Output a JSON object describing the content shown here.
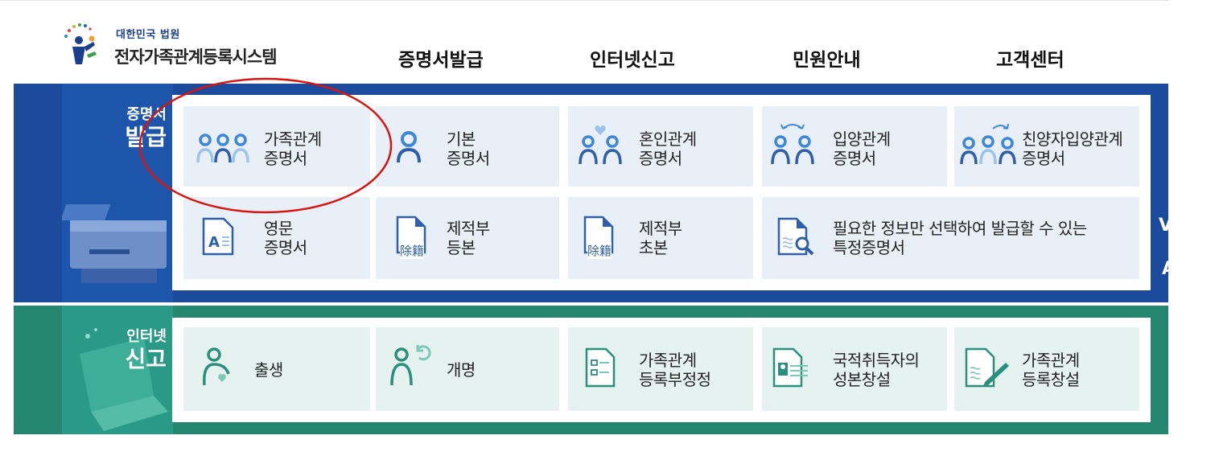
{
  "header": {
    "logo_sub": "대한민국 법원",
    "logo_title": "전자가족관계등록시스템",
    "nav": [
      "증명서발급",
      "인터넷신고",
      "민원안내",
      "고객센터"
    ]
  },
  "certificates": {
    "title_line1": "증명서",
    "title_line2": "발급",
    "tiles": [
      {
        "line1": "가족관계",
        "line2": "증명서",
        "icon": "family-icon"
      },
      {
        "line1": "기본",
        "line2": "증명서",
        "icon": "person-icon"
      },
      {
        "line1": "혼인관계",
        "line2": "증명서",
        "icon": "marriage-icon"
      },
      {
        "line1": "입양관계",
        "line2": "증명서",
        "icon": "adoption-icon"
      },
      {
        "line1": "친양자입양관계",
        "line2": "증명서",
        "icon": "full-adoption-icon"
      },
      {
        "line1": "영문",
        "line2": "증명서",
        "icon": "english-doc-icon"
      },
      {
        "line1": "제적부",
        "line2": "등본",
        "icon": "register-copy-icon",
        "badge": "除籍"
      },
      {
        "line1": "제적부",
        "line2": "초본",
        "icon": "register-extract-icon",
        "badge": "除籍"
      },
      {
        "line1": "필요한 정보만 선택하여 발급할 수 있는",
        "line2": "특정증명서",
        "icon": "doc-search-icon"
      }
    ]
  },
  "internet_report": {
    "title_line1": "인터넷",
    "title_line2": "신고",
    "tiles": [
      {
        "line1": "출생",
        "icon": "birth-icon"
      },
      {
        "line1": "개명",
        "icon": "rename-icon"
      },
      {
        "line1": "가족관계",
        "line2": "등록부정정",
        "icon": "checklist-doc-icon"
      },
      {
        "line1": "국적취득자의",
        "line2": "성본창설",
        "icon": "id-card-icon"
      },
      {
        "line1": "가족관계",
        "line2": "등록창설",
        "icon": "doc-write-icon"
      }
    ]
  },
  "side_fragment": {
    "top": "V",
    "bottom": "A"
  },
  "colors": {
    "blue_band": "#1c4a9c",
    "green_band": "#258670",
    "tile_blue": "#e9eff7",
    "tile_green": "#e5f2ef",
    "highlight": "#d9140e"
  }
}
